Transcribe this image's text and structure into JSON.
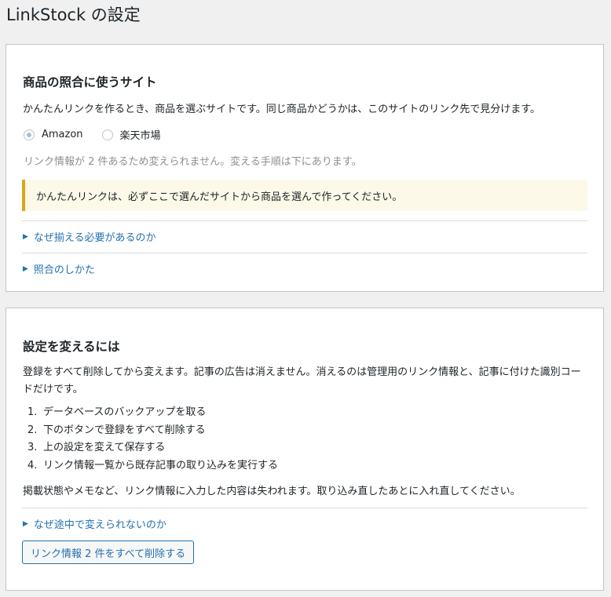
{
  "page": {
    "title": "LinkStock の設定"
  },
  "site_section": {
    "title": "商品の照合に使うサイト",
    "description": "かんたんリンクを作るとき、商品を選ぶサイトです。同じ商品かどうかは、このサイトのリンク先で見分けます。",
    "options": [
      {
        "label": "Amazon",
        "checked": true
      },
      {
        "label": "楽天市場",
        "checked": false
      }
    ],
    "locked_note": "リンク情報が 2 件あるため変えられません。変える手順は下にあります。",
    "notice": "かんたんリンクは、必ずここで選んだサイトから商品を選んで作ってください。",
    "toggles": [
      "なぜ揃える必要があるのか",
      "照合のしかた"
    ]
  },
  "change_section": {
    "title": "設定を変えるには",
    "description": "登録をすべて削除してから変えます。記事の広告は消えません。消えるのは管理用のリンク情報と、記事に付けた識別コードだけです。",
    "steps": [
      "データベースのバックアップを取る",
      "下のボタンで登録をすべて削除する",
      "上の設定を変えて保存する",
      "リンク情報一覧から既存記事の取り込みを実行する"
    ],
    "warning": "掲載状態やメモなど、リンク情報に入力した内容は失われます。取り込み直したあとに入れ直してください。",
    "toggle": "なぜ途中で変えられないのか",
    "delete_button": "リンク情報 2 件をすべて削除する"
  },
  "colors": {
    "accent": "#2271b1",
    "notice_border": "#dba617",
    "notice_bg": "#fcf9e8",
    "muted": "#8c8f94"
  }
}
